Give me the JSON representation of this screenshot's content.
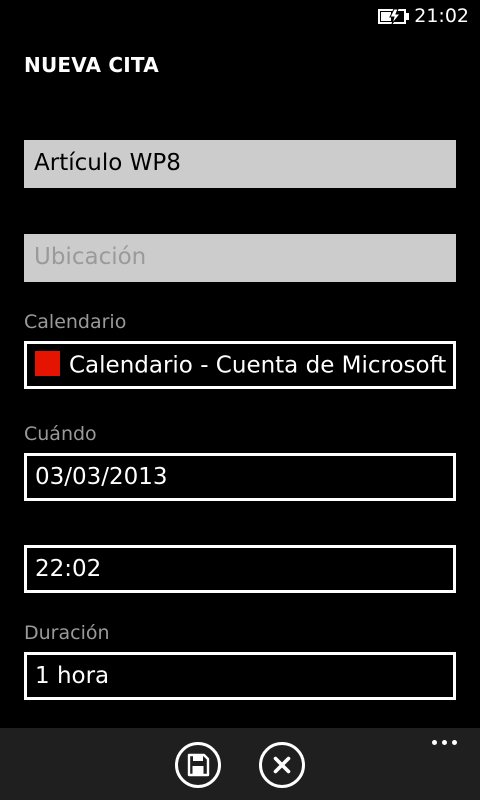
{
  "status_bar": {
    "time": "21:02",
    "battery_icon": "battery-charging-icon"
  },
  "page": {
    "title": "NUEVA CITA"
  },
  "form": {
    "subject": {
      "value": "Artículo WP8"
    },
    "location": {
      "value": "",
      "placeholder": "Ubicación"
    },
    "calendar": {
      "label": "Calendario",
      "value": "Calendario - Cuenta de Microsoft",
      "color": "#e51400"
    },
    "when": {
      "label": "Cuándo",
      "date": "03/03/2013",
      "time": "22:02"
    },
    "duration": {
      "label": "Duración",
      "value": "1 hora"
    }
  },
  "app_bar": {
    "buttons": [
      {
        "icon": "save-icon"
      },
      {
        "icon": "cancel-icon"
      }
    ],
    "more_icon": "ellipsis-icon"
  },
  "colors": {
    "background": "#000000",
    "app_bar": "#1f1f1f",
    "textbox_fill": "#cccccc",
    "label": "#9a9a9a",
    "accent_calendar": "#e51400"
  }
}
